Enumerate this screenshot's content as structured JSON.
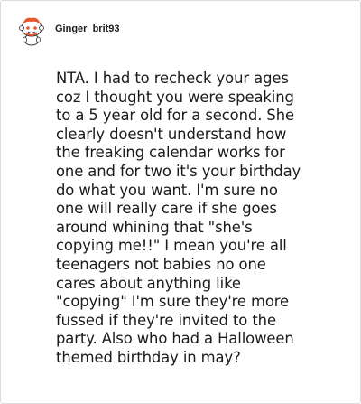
{
  "comment": {
    "author": "Ginger_brit93",
    "avatar_icon": "reddit-snoo-avatar-icon",
    "body": "NTA. I had to recheck your ages\ncoz I thought you were speaking\nto a 5 year old for a second. She\nclearly doesn't understand how\nthe freaking calendar works for\none and for two it's your birthday\ndo what you want. I'm sure no\none will really care if she goes\naround whining that \"she's\ncopying me!!\" I mean you're all\nteenagers not babies no one\ncares about anything like\n\"copying\" I'm sure they're more\nfussed if they're invited to the\nparty. Also who had a Halloween\nthemed birthday in may?"
  },
  "colors": {
    "text": "#1a1a1b",
    "border": "#dcdcdc",
    "avatar_accent": "#e8562a"
  }
}
